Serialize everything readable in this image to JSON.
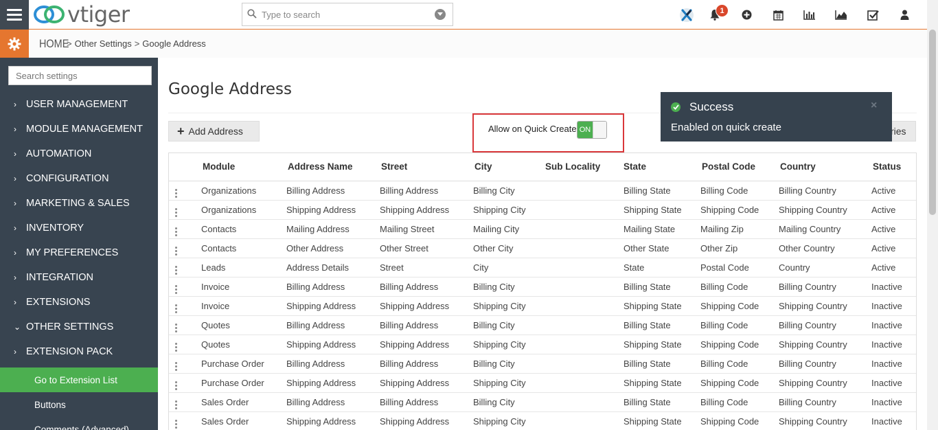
{
  "app": {
    "logo_text": "vtiger"
  },
  "header": {
    "search_placeholder": "Type to search",
    "notification_count": "1",
    "icons": [
      "x-app-icon",
      "bell-icon",
      "plus-circle-icon",
      "calendar-icon",
      "bar-chart-icon",
      "area-chart-icon",
      "tasks-checkbox-icon",
      "user-icon"
    ]
  },
  "breadcrumb": {
    "home": "HOME",
    "sep": ">",
    "level1": "Other Settings",
    "level2": "Google Address"
  },
  "sidebar": {
    "search_placeholder": "Search settings",
    "items": [
      {
        "label": "USER MANAGEMENT",
        "chev": "›"
      },
      {
        "label": "MODULE MANAGEMENT",
        "chev": "›"
      },
      {
        "label": "AUTOMATION",
        "chev": "›"
      },
      {
        "label": "CONFIGURATION",
        "chev": "›"
      },
      {
        "label": "MARKETING & SALES",
        "chev": "›"
      },
      {
        "label": "INVENTORY",
        "chev": "›"
      },
      {
        "label": "MY PREFERENCES",
        "chev": "›"
      },
      {
        "label": "INTEGRATION",
        "chev": "›"
      },
      {
        "label": "EXTENSIONS",
        "chev": "›"
      },
      {
        "label": "OTHER SETTINGS",
        "chev": "⌄"
      },
      {
        "label": "EXTENSION PACK",
        "chev": "›"
      }
    ],
    "sub_items": [
      {
        "label": "Go to Extension List"
      },
      {
        "label": "Buttons"
      },
      {
        "label": "Comments (Advanced)"
      }
    ]
  },
  "main": {
    "title": "Google Address",
    "add_button": "Add Address",
    "quick_create_label": "Allow on Quick Create:",
    "toggle_state": "ON",
    "right_button_fragment": "ries"
  },
  "toast": {
    "title": "Success",
    "message": "Enabled on quick create",
    "close": "×"
  },
  "table": {
    "headers": [
      "Module",
      "Address Name",
      "Street",
      "City",
      "Sub Locality",
      "State",
      "Postal Code",
      "Country",
      "Status"
    ],
    "rows": [
      [
        "Organizations",
        "Billing Address",
        "Billing Address",
        "Billing City",
        "",
        "Billing State",
        "Billing Code",
        "Billing Country",
        "Active"
      ],
      [
        "Organizations",
        "Shipping Address",
        "Shipping Address",
        "Shipping City",
        "",
        "Shipping State",
        "Shipping Code",
        "Shipping Country",
        "Active"
      ],
      [
        "Contacts",
        "Mailing Address",
        "Mailing Street",
        "Mailing City",
        "",
        "Mailing State",
        "Mailing Zip",
        "Mailing Country",
        "Active"
      ],
      [
        "Contacts",
        "Other Address",
        "Other Street",
        "Other City",
        "",
        "Other State",
        "Other Zip",
        "Other Country",
        "Active"
      ],
      [
        "Leads",
        "Address Details",
        "Street",
        "City",
        "",
        "State",
        "Postal Code",
        "Country",
        "Active"
      ],
      [
        "Invoice",
        "Billing Address",
        "Billing Address",
        "Billing City",
        "",
        "Billing State",
        "Billing Code",
        "Billing Country",
        "Inactive"
      ],
      [
        "Invoice",
        "Shipping Address",
        "Shipping Address",
        "Shipping City",
        "",
        "Shipping State",
        "Shipping Code",
        "Shipping Country",
        "Inactive"
      ],
      [
        "Quotes",
        "Billing Address",
        "Billing Address",
        "Billing City",
        "",
        "Billing State",
        "Billing Code",
        "Billing Country",
        "Inactive"
      ],
      [
        "Quotes",
        "Shipping Address",
        "Shipping Address",
        "Shipping City",
        "",
        "Shipping State",
        "Shipping Code",
        "Shipping Country",
        "Inactive"
      ],
      [
        "Purchase Order",
        "Billing Address",
        "Billing Address",
        "Billing City",
        "",
        "Billing State",
        "Billing Code",
        "Billing Country",
        "Inactive"
      ],
      [
        "Purchase Order",
        "Shipping Address",
        "Shipping Address",
        "Shipping City",
        "",
        "Shipping State",
        "Shipping Code",
        "Shipping Country",
        "Inactive"
      ],
      [
        "Sales Order",
        "Billing Address",
        "Billing Address",
        "Billing City",
        "",
        "Billing State",
        "Billing Code",
        "Billing Country",
        "Inactive"
      ],
      [
        "Sales Order",
        "Shipping Address",
        "Shipping Address",
        "Shipping City",
        "",
        "Shipping State",
        "Shipping Code",
        "Shipping Country",
        "Inactive"
      ]
    ]
  },
  "colors": {
    "accent": "#e5762f",
    "sidebar": "#384450",
    "active": "#4caf50",
    "highlight": "#d9373a"
  }
}
